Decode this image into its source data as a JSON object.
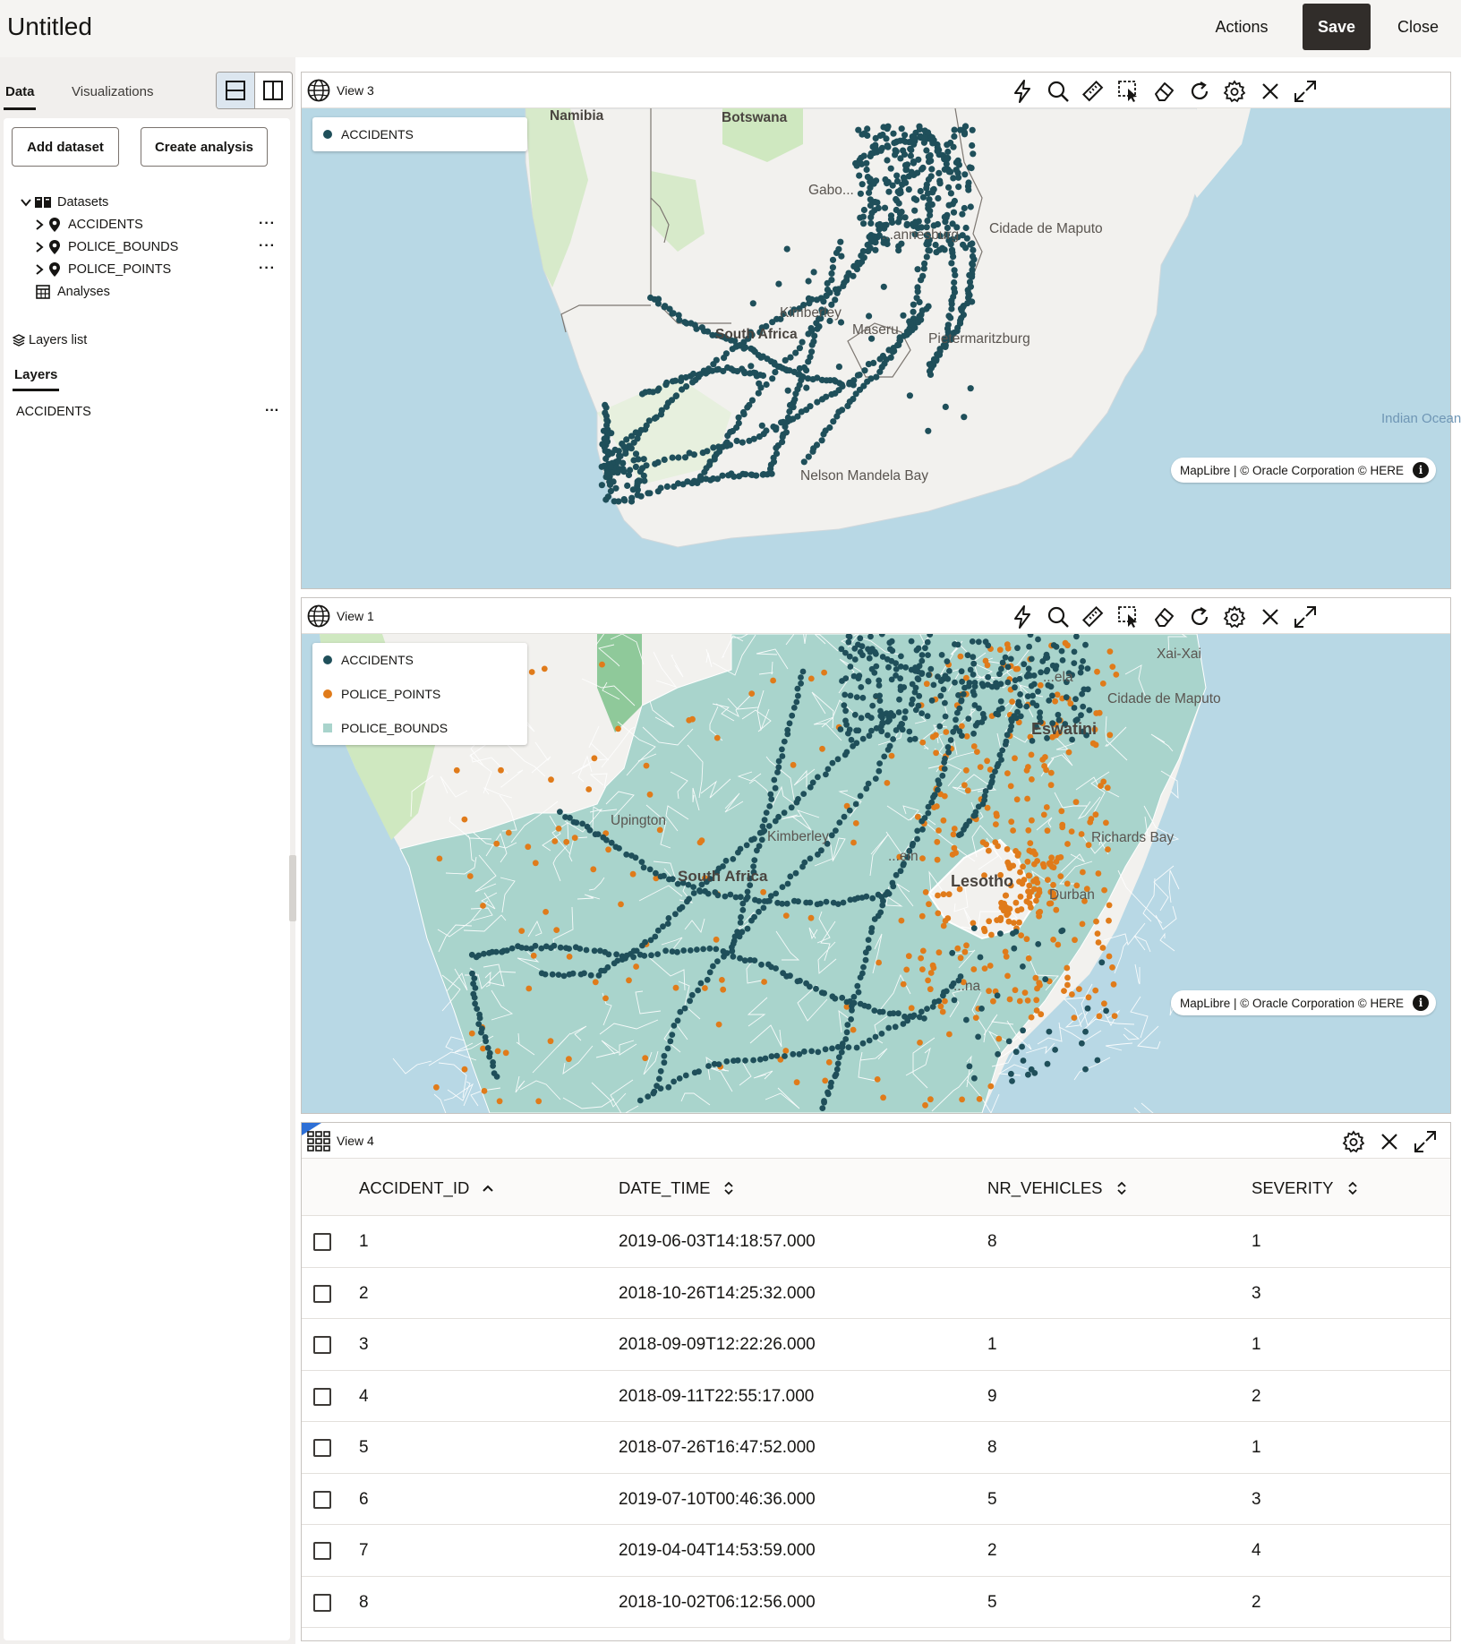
{
  "header": {
    "title": "Untitled",
    "actions_label": "Actions",
    "save_label": "Save",
    "close_label": "Close"
  },
  "left_panel": {
    "tabs": [
      {
        "label": "Data"
      },
      {
        "label": "Visualizations"
      }
    ],
    "add_dataset_label": "Add dataset",
    "create_analysis_label": "Create analysis",
    "tree": {
      "datasets_label": "Datasets",
      "items": [
        {
          "label": "ACCIDENTS"
        },
        {
          "label": "POLICE_BOUNDS"
        },
        {
          "label": "POLICE_POINTS"
        }
      ],
      "analyses_label": "Analyses",
      "more_glyph": "···"
    },
    "layers": {
      "title": "Layers list",
      "tab_label": "Layers",
      "items": [
        {
          "label": "ACCIDENTS"
        }
      ]
    }
  },
  "views": {
    "view3": {
      "title": "View 3",
      "legend": [
        {
          "label": "ACCIDENTS",
          "color": "#1f4f5a"
        }
      ],
      "labels": {
        "namibia": "Namibia",
        "botswana": "Botswana",
        "gaborone": "Gabo...",
        "johannesburg": "...annesburg",
        "maputo": "Cidade de Maputo",
        "kimberley": "Kimberley",
        "south_africa": "South Africa",
        "maseru": "Maseru",
        "pietermaritzburg": "Pietermaritzburg",
        "nelson_mandela_bay": "Nelson Mandela Bay",
        "indian_ocean": "Indian Ocean"
      },
      "attribution": "MapLibre | © Oracle Corporation   © HERE"
    },
    "view1": {
      "title": "View 1",
      "legend": [
        {
          "label": "ACCIDENTS",
          "color": "#1f4f5a"
        },
        {
          "label": "POLICE_POINTS",
          "color": "#e07b1a"
        },
        {
          "label": "POLICE_BOUNDS",
          "color": "#a9d4cc"
        }
      ],
      "labels": {
        "xai_xai": "Xai-Xai",
        "maputo": "Cidade de Maputo",
        "eswatini": "Eswatini",
        "richards_bay": "Richards Bay",
        "lesotho": "Lesotho",
        "durban": "Durban",
        "south_africa": "South Africa",
        "kimberley": "Kimberley",
        "upington": "Upington",
        "ela": "...ela",
        "ein": "...ein",
        "na": "...na"
      },
      "attribution": "MapLibre | © Oracle Corporation   © HERE"
    },
    "view4": {
      "title": "View 4",
      "columns": [
        "ACCIDENT_ID",
        "DATE_TIME",
        "NR_VEHICLES",
        "SEVERITY"
      ],
      "rows": [
        {
          "id": "1",
          "date_time": "2019-06-03T14:18:57.000",
          "nr_vehicles": "8",
          "severity": "1"
        },
        {
          "id": "2",
          "date_time": "2018-10-26T14:25:32.000",
          "nr_vehicles": "",
          "severity": "3"
        },
        {
          "id": "3",
          "date_time": "2018-09-09T12:22:26.000",
          "nr_vehicles": "1",
          "severity": "1"
        },
        {
          "id": "4",
          "date_time": "2018-09-11T22:55:17.000",
          "nr_vehicles": "9",
          "severity": "2"
        },
        {
          "id": "5",
          "date_time": "2018-07-26T16:47:52.000",
          "nr_vehicles": "8",
          "severity": "1"
        },
        {
          "id": "6",
          "date_time": "2019-07-10T00:46:36.000",
          "nr_vehicles": "5",
          "severity": "3"
        },
        {
          "id": "7",
          "date_time": "2019-04-04T14:53:59.000",
          "nr_vehicles": "2",
          "severity": "4"
        },
        {
          "id": "8",
          "date_time": "2018-10-02T06:12:56.000",
          "nr_vehicles": "5",
          "severity": "2"
        }
      ]
    }
  },
  "icons": {
    "map_tools": [
      "lightning-icon",
      "zoom-icon",
      "measure-ruler-icon",
      "select-region-icon",
      "eraser-icon",
      "refresh-icon",
      "settings-gear-icon",
      "close-icon",
      "expand-icon"
    ],
    "table_tools": [
      "settings-gear-icon",
      "close-icon",
      "expand-icon"
    ]
  },
  "colors": {
    "accent": "#312d2a",
    "accident_point": "#1f4f5a",
    "police_point": "#e07b1a",
    "police_bounds": "#a9d4cc",
    "ocean": "#b8d8e5",
    "land": "#f2f1ee",
    "parks": "#cfe8c0"
  }
}
